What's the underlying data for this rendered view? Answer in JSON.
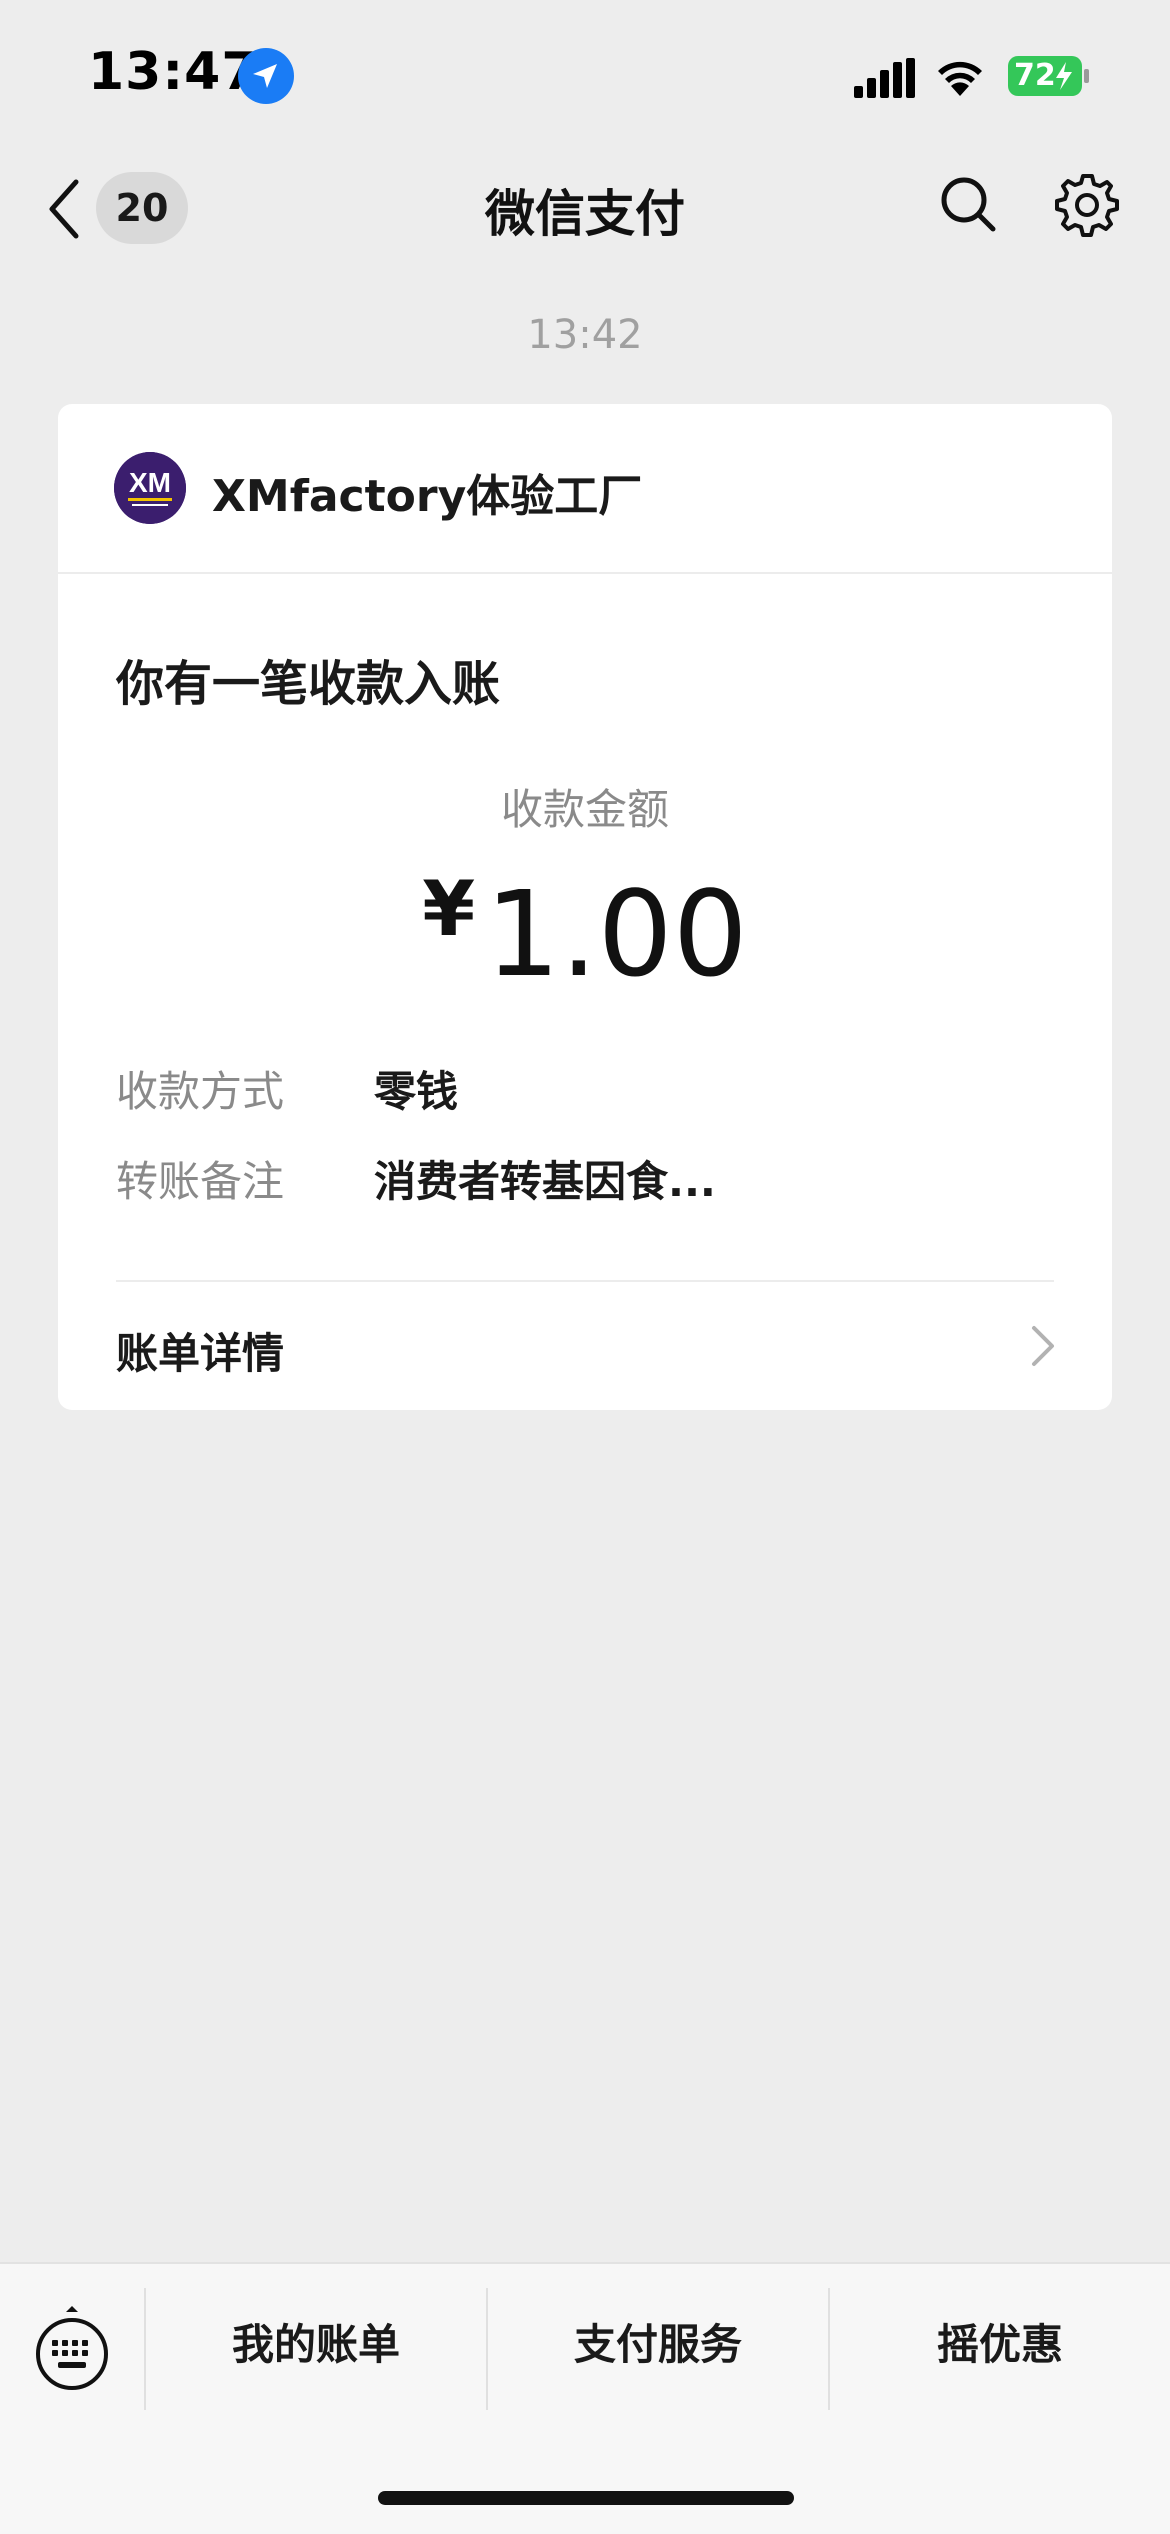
{
  "status_bar": {
    "time": "13:47",
    "battery_level": "72",
    "battery_color": "#34c759"
  },
  "nav": {
    "unread_count": "20",
    "title": "微信支付"
  },
  "message": {
    "timestamp": "13:42",
    "merchant_name": "XMfactory体验工厂",
    "merchant_logo_text": "XM",
    "heading": "你有一笔收款入账",
    "amount_label": "收款金额",
    "currency": "¥",
    "amount": "1.00",
    "details": [
      {
        "label": "收款方式",
        "value": "零钱"
      },
      {
        "label": "转账备注",
        "value": "消费者转基因食..."
      }
    ],
    "bill_detail_label": "账单详情"
  },
  "bottom_menu": {
    "items": [
      {
        "label": "我的账单"
      },
      {
        "label": "支付服务"
      },
      {
        "label": "摇优惠"
      }
    ]
  },
  "icons": [
    "location-icon",
    "signal-icon",
    "wifi-icon",
    "battery-icon",
    "back-icon",
    "search-icon",
    "gear-icon",
    "chevron-right-icon",
    "keyboard-icon"
  ]
}
